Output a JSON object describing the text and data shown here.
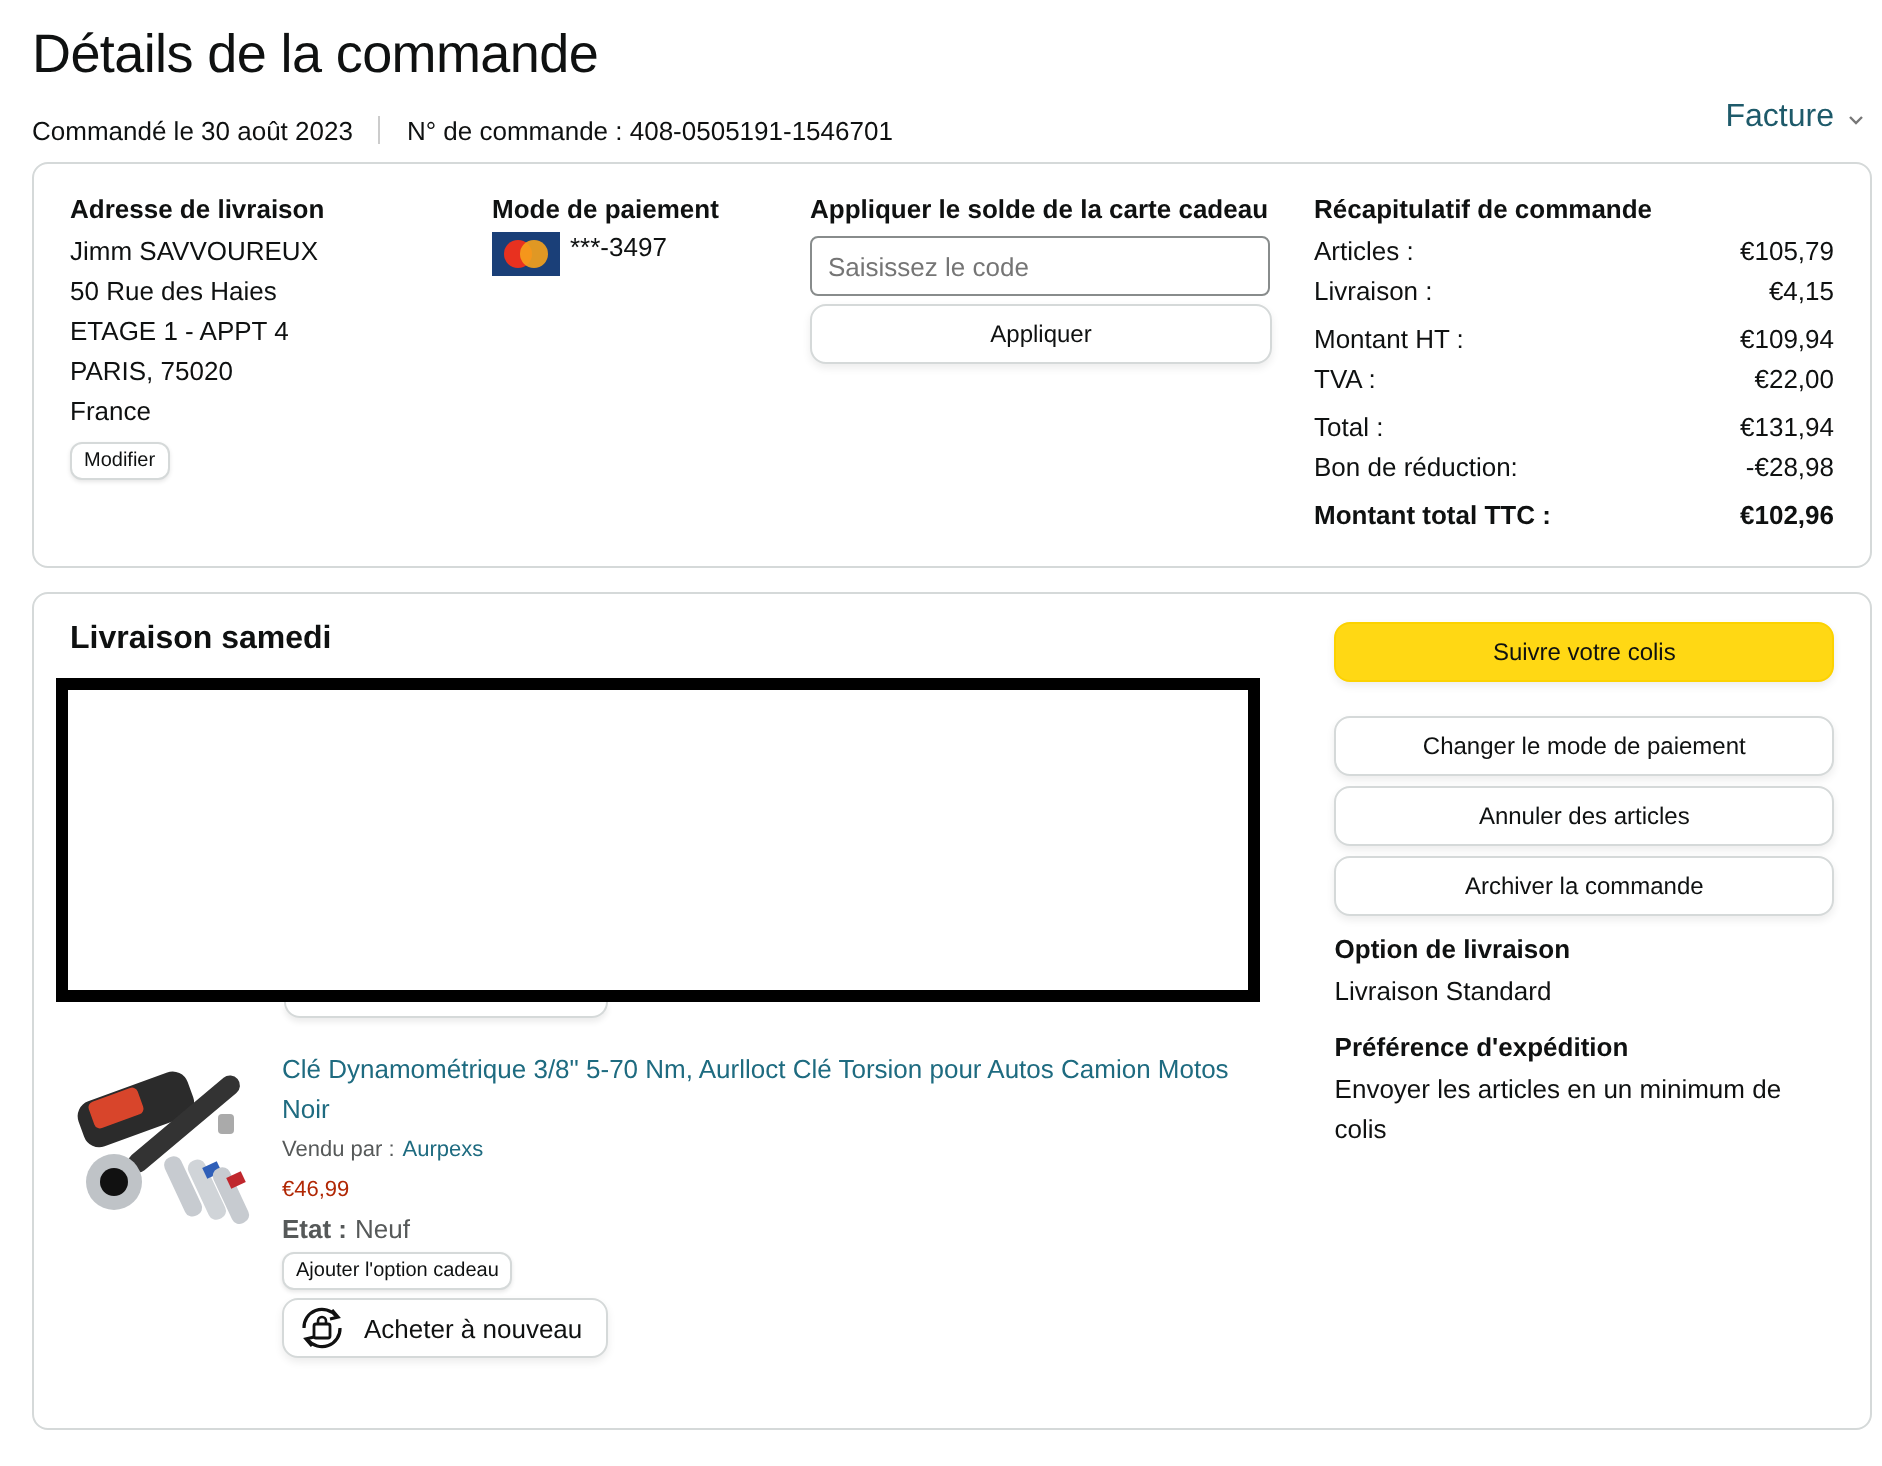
{
  "page": {
    "title": "Détails de la commande",
    "order_date": "Commandé le 30 août 2023",
    "order_number": "N° de commande : 408-0505191-1546701",
    "invoice_link": "Facture"
  },
  "summary_card": {
    "address": {
      "heading": "Adresse de livraison",
      "lines": [
        "Jimm SAVVOUREUX",
        "50 Rue des Haies",
        "ETAGE 1 - APPT 4",
        "PARIS, 75020",
        "France"
      ],
      "button": "Modifier"
    },
    "payment": {
      "heading": "Mode de paiement",
      "card": "***-3497"
    },
    "gift_card": {
      "heading": "Appliquer le solde de la carte cadeau",
      "placeholder": "Saisissez le code",
      "button": "Appliquer"
    },
    "order_summary": {
      "heading": "Récapitulatif de commande",
      "groups": [
        [
          {
            "label": "Articles :",
            "value": "€105,79"
          },
          {
            "label": "Livraison :",
            "value": "€4,15"
          }
        ],
        [
          {
            "label": "Montant HT :",
            "value": "€109,94"
          },
          {
            "label": "TVA :",
            "value": "€22,00"
          }
        ],
        [
          {
            "label": "Total :",
            "value": "€131,94"
          },
          {
            "label": "Bon de réduction:",
            "value": "-€28,98"
          }
        ],
        [
          {
            "label": "Montant total TTC :",
            "value": "€102,96",
            "kind": "grand_total"
          }
        ]
      ]
    }
  },
  "shipment": {
    "heading": "Livraison samedi",
    "items": [
      {
        "kind": "redacted"
      },
      {
        "kind": "product",
        "title": "Clé Dynamométrique 3/8\" 5-70 Nm, Aurlloct Clé Torsion pour Autos Camion Motos Noir",
        "seller_label": "Vendu par :",
        "seller": "Aurpexs",
        "price": "€46,99",
        "condition_label": "Etat :",
        "condition": "Neuf",
        "gift_button": "Ajouter l'option cadeau",
        "buy_again": "Acheter à nouveau"
      }
    ],
    "actions": [
      {
        "label": "Suivre votre colis",
        "kind": "primary"
      },
      {
        "label": "Changer le mode de paiement",
        "kind": "secondary"
      },
      {
        "label": "Annuler des articles",
        "kind": "secondary"
      },
      {
        "label": "Archiver la commande",
        "kind": "secondary"
      }
    ],
    "info": [
      {
        "heading": "Option de livraison",
        "text": "Livraison Standard"
      },
      {
        "heading": "Préférence d'expédition",
        "text": "Envoyer les articles en un minimum de colis"
      }
    ]
  }
}
